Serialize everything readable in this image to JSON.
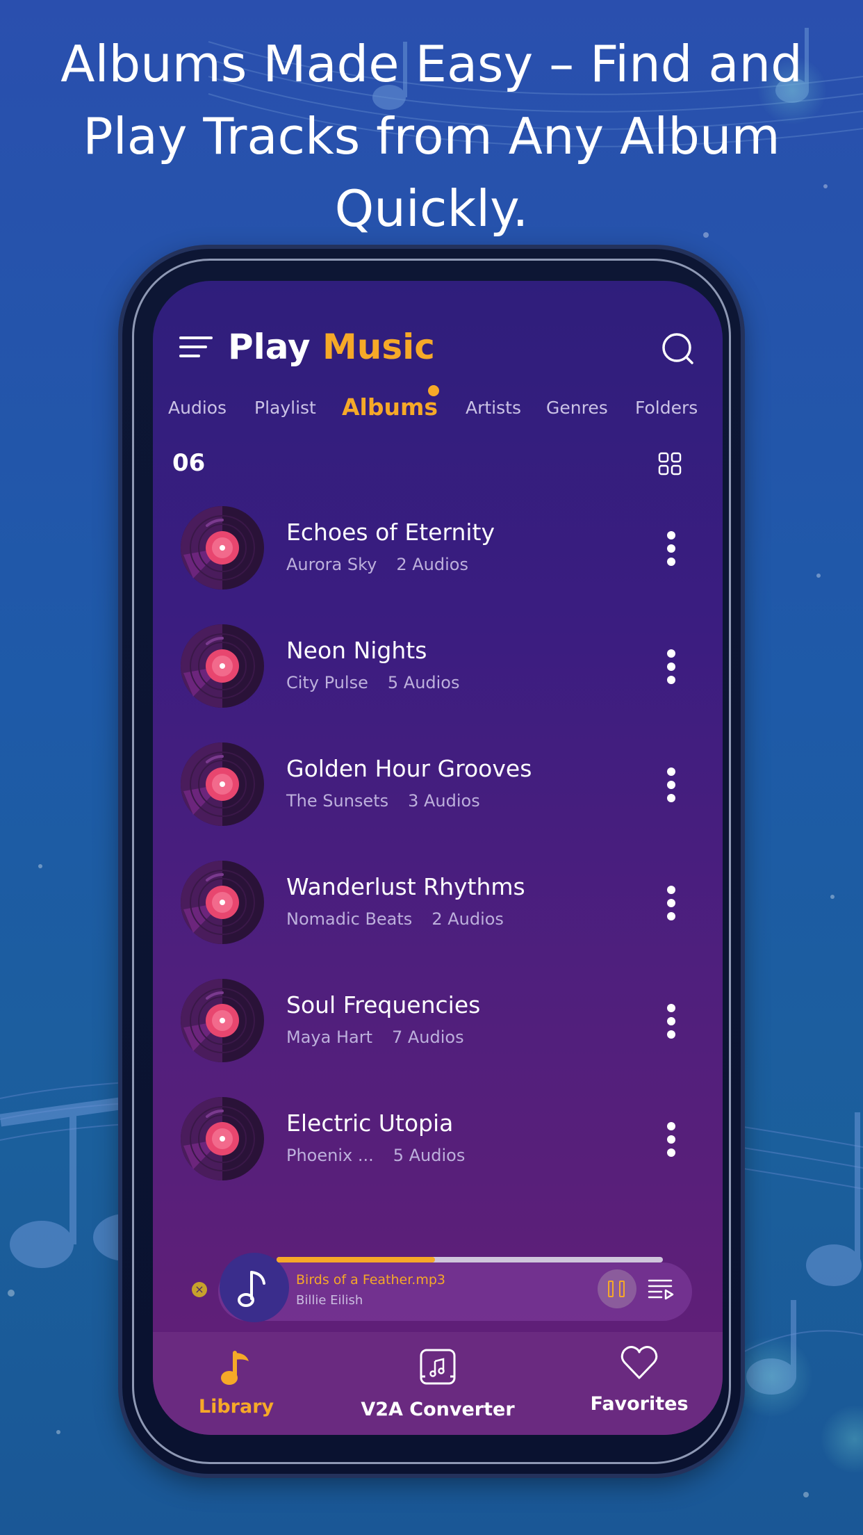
{
  "headline": "Albums Made Easy – Find and Play Tracks from Any Album Quickly.",
  "app": {
    "title_part1": "Play",
    "title_part2": "Music"
  },
  "tabs": [
    {
      "label": "Audios",
      "active": false
    },
    {
      "label": "Playlist",
      "active": false
    },
    {
      "label": "Albums",
      "active": true
    },
    {
      "label": "Artists",
      "active": false
    },
    {
      "label": "Genres",
      "active": false
    },
    {
      "label": "Folders",
      "active": false
    }
  ],
  "album_count": "06",
  "albums": [
    {
      "title": "Echoes of Eternity",
      "artist": "Aurora Sky",
      "audios": "2 Audios"
    },
    {
      "title": "Neon Nights",
      "artist": "City Pulse",
      "audios": "5 Audios"
    },
    {
      "title": "Golden Hour Grooves",
      "artist": "The Sunsets",
      "audios": "3 Audios"
    },
    {
      "title": "Wanderlust Rhythms",
      "artist": "Nomadic Beats",
      "audios": "2 Audios"
    },
    {
      "title": "Soul Frequencies",
      "artist": "Maya Hart",
      "audios": "7 Audios"
    },
    {
      "title": "Electric Utopia",
      "artist": "Phoenix ...",
      "audios": "5 Audios"
    }
  ],
  "now_playing": {
    "title": "Birds of a Feather.mp3",
    "artist": "Billie Eilish",
    "progress": 0.41
  },
  "bottom_nav": [
    {
      "label": "Library",
      "icon": "music-note-icon",
      "active": true
    },
    {
      "label": "V2A Converter",
      "icon": "converter-icon",
      "active": false
    },
    {
      "label": "Favorites",
      "icon": "heart-icon",
      "active": false
    }
  ],
  "colors": {
    "accent": "#f6a928",
    "text_primary": "#ffffff",
    "text_secondary": "#bdb0dc"
  }
}
